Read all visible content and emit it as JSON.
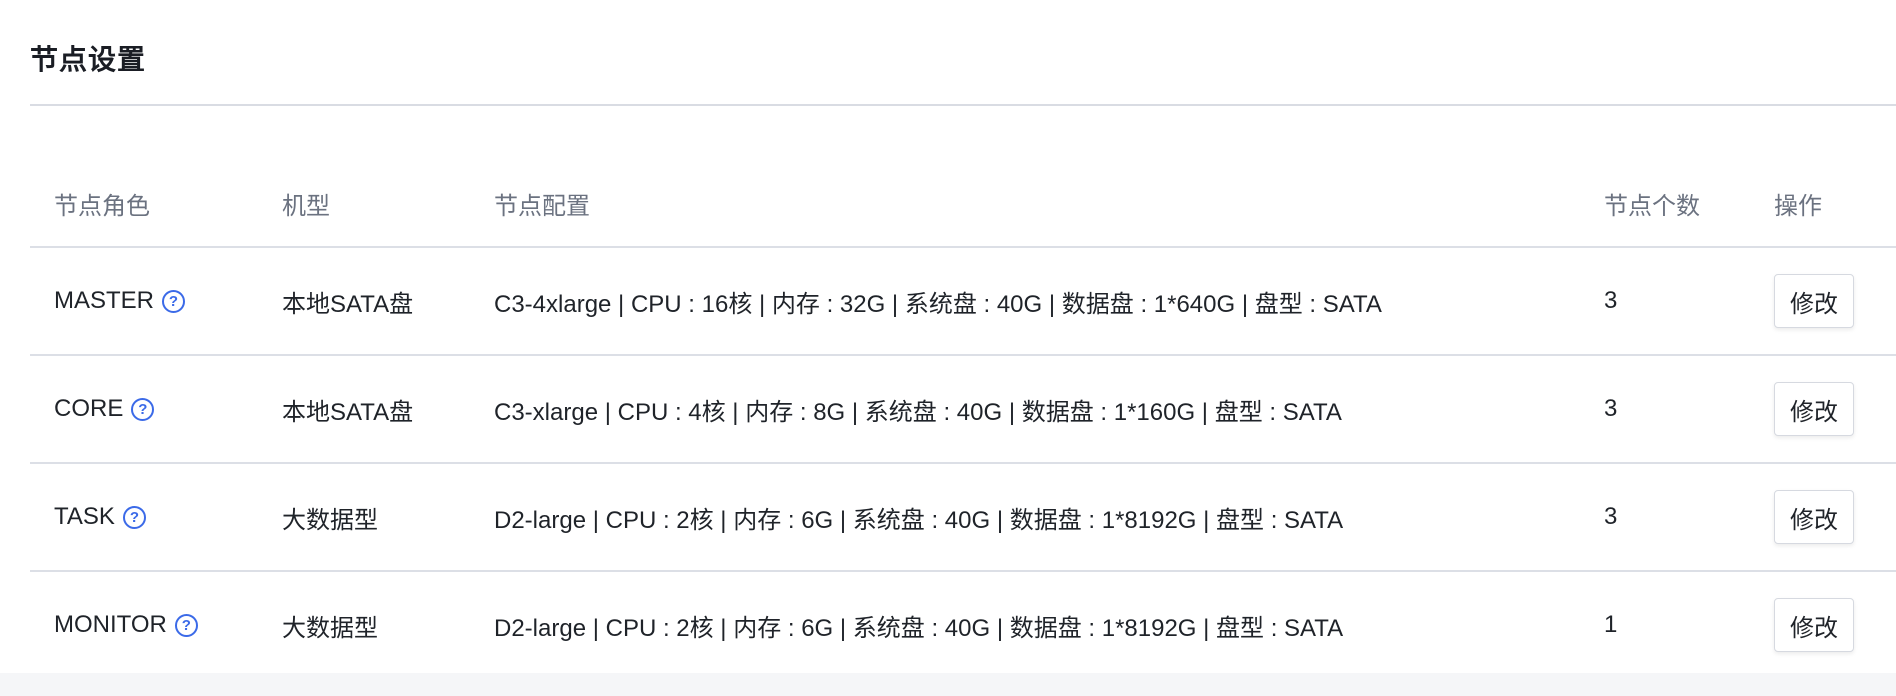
{
  "section": {
    "title": "节点设置"
  },
  "table": {
    "headers": {
      "role": "节点角色",
      "type": "机型",
      "config": "节点配置",
      "count": "节点个数",
      "operation": "操作"
    },
    "rows": [
      {
        "role": "MASTER",
        "type": "本地SATA盘",
        "config": "C3-4xlarge | CPU : 16核 | 内存 : 32G | 系统盘 : 40G | 数据盘 : 1*640G | 盘型 : SATA",
        "count": "3",
        "action": "修改"
      },
      {
        "role": "CORE",
        "type": "本地SATA盘",
        "config": "C3-xlarge | CPU : 4核 | 内存 : 8G | 系统盘 : 40G | 数据盘 : 1*160G | 盘型 : SATA",
        "count": "3",
        "action": "修改"
      },
      {
        "role": "TASK",
        "type": "大数据型",
        "config": "D2-large | CPU : 2核 | 内存 : 6G | 系统盘 : 40G | 数据盘 : 1*8192G | 盘型 : SATA",
        "count": "3",
        "action": "修改"
      },
      {
        "role": "MONITOR",
        "type": "大数据型",
        "config": "D2-large | CPU : 2核 | 内存 : 6G | 系统盘 : 40G | 数据盘 : 1*8192G | 盘型 : SATA",
        "count": "1",
        "action": "修改"
      }
    ]
  },
  "icons": {
    "help": "question-circle-icon",
    "help_glyph": "?"
  },
  "colors": {
    "accent": "#3b6ae8",
    "divider": "#dcdfe6",
    "header_text": "#6b7280"
  }
}
